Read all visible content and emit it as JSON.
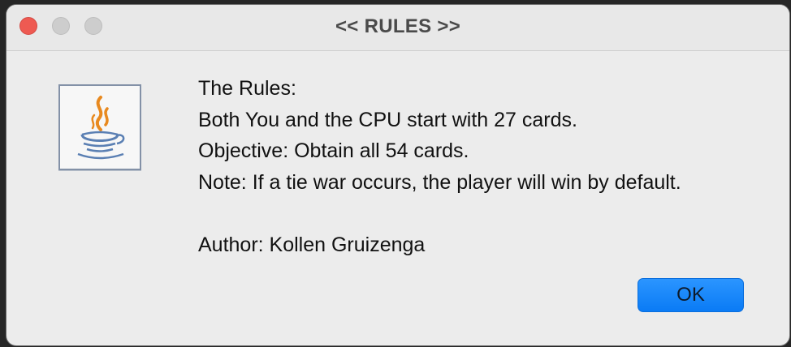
{
  "window": {
    "title": "<< RULES >>"
  },
  "icon": {
    "name": "java-logo-icon"
  },
  "message": {
    "lines": [
      "The Rules:",
      "Both You and the CPU start with 27 cards.",
      "Objective: Obtain all 54 cards.",
      "Note: If a tie war occurs, the player will win by default.",
      "",
      "Author: Kollen Gruizenga"
    ]
  },
  "buttons": {
    "ok_label": "OK"
  },
  "colors": {
    "close": "#ee5a52",
    "inactive_light": "#cdcdcd",
    "accent": "#0a7bf5",
    "java_orange": "#e8891f",
    "java_blue": "#5a7fb3"
  }
}
